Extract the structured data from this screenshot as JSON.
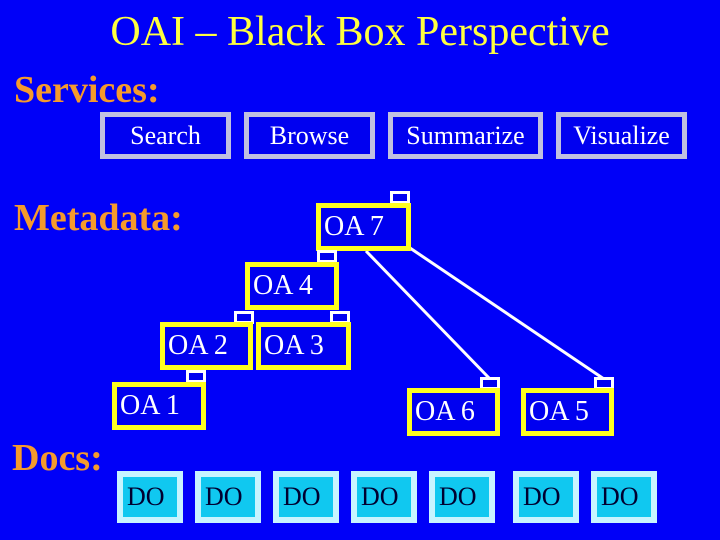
{
  "title": "OAI – Black Box Perspective",
  "sections": {
    "services": "Services:",
    "metadata": "Metadata:",
    "docs": "Docs:"
  },
  "services": [
    "Search",
    "Browse",
    "Summarize",
    "Visualize"
  ],
  "archives": {
    "oa7": "OA 7",
    "oa4": "OA 4",
    "oa2": "OA 2",
    "oa3": "OA 3",
    "oa1": "OA 1",
    "oa6": "OA 6",
    "oa5": "OA 5"
  },
  "docs": [
    "DO",
    "DO",
    "DO",
    "DO",
    "DO",
    "DO",
    "DO"
  ],
  "connections": [
    {
      "from": "OA 7",
      "to": "OA 6"
    },
    {
      "from": "OA 7",
      "to": "OA 5"
    }
  ],
  "colors": {
    "background": "#0000f8",
    "title": "#ffff40",
    "section_label": "#f59a2c",
    "archive_border": "#ffff20",
    "service_border": "#c0c0e0",
    "doc_fill": "#10c8f0"
  }
}
